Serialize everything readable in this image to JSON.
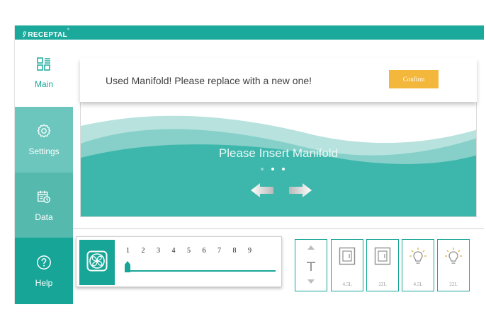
{
  "app": {
    "logo": "RECEPTAL",
    "brand_color": "#1aa99b"
  },
  "sidebar": {
    "items": [
      {
        "label": "Main",
        "icon": "layout-list-icon",
        "active": true
      },
      {
        "label": "Settings",
        "icon": "gear-icon"
      },
      {
        "label": "Data",
        "icon": "calendar-clock-icon"
      },
      {
        "label": "Help",
        "icon": "question-circle-icon"
      }
    ]
  },
  "alert": {
    "message": "Used Manifold! Please replace with a new one!",
    "confirm_label": "Confirm",
    "confirm_color": "#f3b73b"
  },
  "banner": {
    "message": "Please Insert Manifold",
    "carousel_dots": 3,
    "active_dot": 2
  },
  "speed": {
    "icon": "fan-icon",
    "scale": [
      "1",
      "2",
      "3",
      "4",
      "5",
      "6",
      "7",
      "8",
      "9"
    ],
    "value": 1
  },
  "tiles": [
    {
      "icon": "valve-up-down-icon",
      "caption": ""
    },
    {
      "icon": "canister-icon",
      "caption": "4.5L"
    },
    {
      "icon": "canister-icon",
      "caption": "22L"
    },
    {
      "icon": "light-bulb-icon",
      "caption": "4.5L"
    },
    {
      "icon": "light-bulb-icon",
      "caption": "22L"
    }
  ]
}
